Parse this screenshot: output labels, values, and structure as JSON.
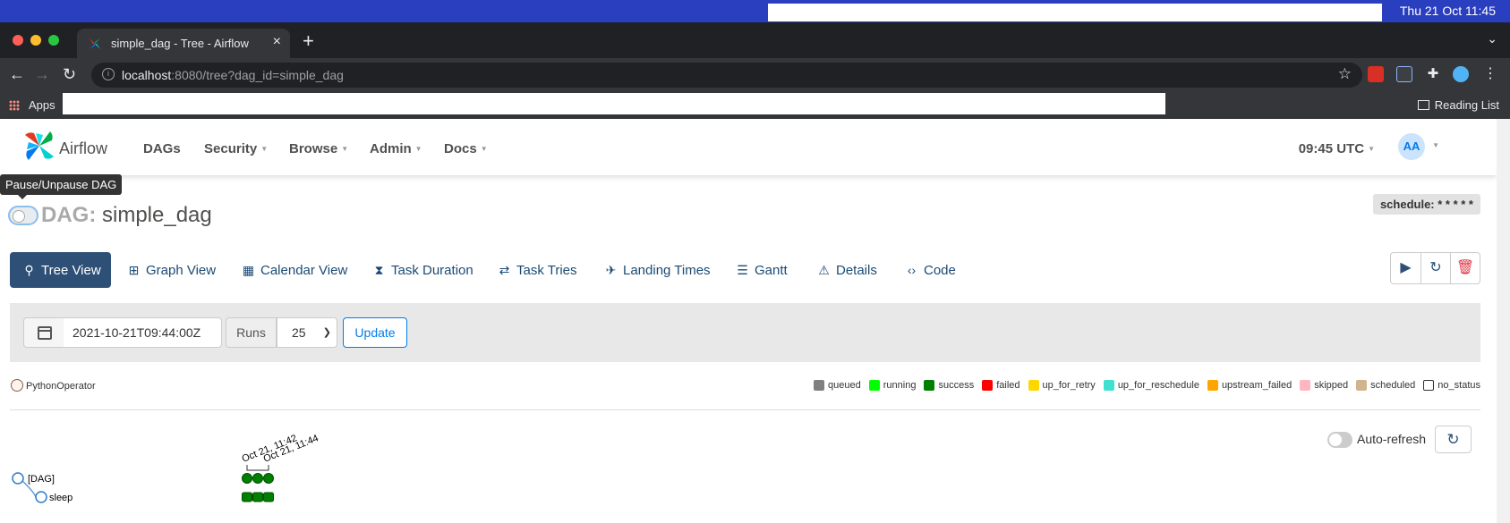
{
  "os": {
    "clock": "Thu 21 Oct  11:45"
  },
  "browser": {
    "tab_title": "simple_dag - Tree - Airflow",
    "url_host": "localhost",
    "url_rest": ":8080/tree?dag_id=simple_dag",
    "bookmarks_apps": "Apps",
    "reading_list": "Reading List"
  },
  "nav": {
    "brand": "Airflow",
    "menus": [
      "DAGs",
      "Security",
      "Browse",
      "Admin",
      "Docs"
    ],
    "time": "09:45 UTC",
    "avatar": "AA"
  },
  "tooltip": "Pause/Unpause DAG",
  "dag": {
    "prefix": "DAG:",
    "name": "simple_dag",
    "schedule": "schedule: * * * * *"
  },
  "views": [
    "Tree View",
    "Graph View",
    "Calendar View",
    "Task Duration",
    "Task Tries",
    "Landing Times",
    "Gantt",
    "Details",
    "Code"
  ],
  "filters": {
    "base_date": "2021-10-21T09:44:00Z",
    "runs_label": "Runs",
    "runs_value": "25",
    "update_label": "Update"
  },
  "operator_legend": "PythonOperator",
  "states": [
    {
      "name": "queued",
      "color": "#808080"
    },
    {
      "name": "running",
      "color": "#00ff00"
    },
    {
      "name": "success",
      "color": "#008000"
    },
    {
      "name": "failed",
      "color": "#ff0000"
    },
    {
      "name": "up_for_retry",
      "color": "#ffd700"
    },
    {
      "name": "up_for_reschedule",
      "color": "#40e0d0"
    },
    {
      "name": "upstream_failed",
      "color": "#ffa500"
    },
    {
      "name": "skipped",
      "color": "#ffb6c1"
    },
    {
      "name": "scheduled",
      "color": "#d2b48c"
    },
    {
      "name": "no_status",
      "color": "#ffffff"
    }
  ],
  "auto_refresh_label": "Auto-refresh",
  "tree": {
    "date_labels": [
      "Oct 21, 11:42",
      "Oct 21, 11:44"
    ],
    "nodes": [
      "[DAG]",
      "sleep"
    ],
    "run_count": 3
  }
}
